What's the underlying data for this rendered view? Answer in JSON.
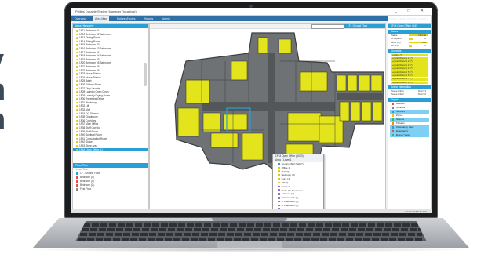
{
  "window": {
    "title": "Philips Durable System Manager (localhost)",
    "controls": "_ □ ✕"
  },
  "tabs": [
    "Overview",
    "Area Map",
    "Fixtures/Nodes",
    "Reports",
    "Admin"
  ],
  "active_tab": 1,
  "topbar_right": "admin  |  Signed in  |  Help  |  Logout",
  "left_panel": {
    "header": "Area Hierarchy",
    "areas": [
      "1F11 Bedroom 01",
      "1F12 Bedroom 02 Bathroom",
      "1F13 Dining Room",
      "1F14 Sitting Room",
      "1F15 Bedroom 03",
      "1F16 Bedroom 03 Bathroom",
      "1F17 Bedroom 04",
      "1F18 Bedroom 04 Bathroom",
      "1F19 Bedroom 05",
      "1F20 Bedroom 05 Bathroom",
      "1F21 Bedroom 06",
      "1F22 Bedroom 06",
      "1F23 Nurse Station",
      "1F24 Nurse Station",
      "1F25 Toilet",
      "1F26 Kitchen Room",
      "1F27 Dirty Laundry",
      "1F28 Laundry Open Clean",
      "1F29 Laundry Drying Room",
      "1F30 Receiving Office",
      "1F31 Workshop",
      "1F32 Lift",
      "1F33 Mail",
      "1F34 DQ Shower",
      "1F35 Cloakroom",
      "1F36 Corridors",
      "1F37 Main Office",
      "1F38 Staff Corridor",
      "1F39 Staff Room",
      "1F40 Spiritual Room",
      "1F41 Consultation Room",
      "1F42 Sluice",
      "1F43 Store Area",
      "1F44 Open Office (L)"
    ],
    "selected_index": 33,
    "legend_header": "Floor Plan",
    "legend_caption": "Level Tree",
    "legend": [
      {
        "label": "1F - Ground Floor",
        "color": "#2a9fd6"
      },
      {
        "label": "Bedroom (4)",
        "color": "#e05050"
      },
      {
        "label": "Bedroom (4)",
        "color": "#e05050"
      },
      {
        "label": "Bedroom (2)",
        "color": "#e05050"
      },
      {
        "label": "First Floor",
        "color": "#8a8a8a"
      }
    ]
  },
  "map_toolbar": {
    "search_placeholder": "",
    "button": "1F - Ground Floor"
  },
  "popup": {
    "title": "1F44 Open Office (N003)",
    "subtitle": "Area    1 Level 1",
    "groups": [
      {
        "label": "Groups: 8F2 Hall (7)",
        "color": "#2a9fd6"
      },
      {
        "label": "Office 1",
        "color": "#e6c21a"
      },
      {
        "label": "Hall (7)",
        "color": "#e6c21a"
      },
      {
        "label": "Bedroom (4)",
        "color": "#e6c21a"
      },
      {
        "label": "Core (4)",
        "color": "#e6c21a"
      },
      {
        "label": "Off (4)",
        "color": "#e6c21a"
      },
      {
        "label": "Controls",
        "color": "#9a6ac8"
      },
      {
        "label": "Node On   Set Scene",
        "color": "#9a6ac8"
      },
      {
        "label": "A   Scene (7)",
        "color": "#9a6ac8"
      },
      {
        "label": "B   Channel 1 (4)",
        "color": "#9a6ac8"
      },
      {
        "label": "C   Channel 2 (4)",
        "color": "#9a6ac8"
      },
      {
        "label": "D   Channel 3 (4)",
        "color": "#9a6ac8"
      },
      {
        "label": "E   Channel 4 (4)",
        "color": "#9a6ac8"
      }
    ]
  },
  "right_panel": {
    "area_button": "1F44 Open Office (N4)",
    "sections": {
      "status_header": "Status",
      "status": [
        {
          "label": "Status",
          "value": "Normal",
          "fill": 1.0
        },
        {
          "label": "Occupancy",
          "value": "0",
          "fill": 0.2
        },
        {
          "label": "Level (%)",
          "value": "100",
          "fill": 1.0
        },
        {
          "label": "Off (%)",
          "value": "0",
          "fill": 0.15
        }
      ],
      "channels_header": "Channels",
      "channels": [
        "Lighting (7)",
        "Logical Channel 1 (7)",
        "Logical Channel 2 (7)",
        "Logical Channel 3 (7)",
        "Logical Channel 4 (7)",
        "Logical Channel 5 (7)",
        "Logical Channel 6 (7)",
        "Logical Channel 7 (7)",
        "Logical Channel 8 (7)"
      ],
      "scene_header": "Scene Information",
      "scenes": [
        {
          "label": "Scene Info 1",
          "value": "DACT1"
        },
        {
          "label": "Scene Info 2",
          "value": "DACT2"
        }
      ],
      "layers_header": "Layers",
      "layers": [
        {
          "label": "Devices",
          "color": "#e05050",
          "on": false
        },
        {
          "label": "Controls",
          "color": "#9a6ac8",
          "on": false
        },
        {
          "label": "Sensors",
          "color": "#2a9fd6",
          "on": true
        },
        {
          "label": "Zones",
          "color": "#e6c21a",
          "on": false
        },
        {
          "label": "Scenes",
          "color": "#3cb371",
          "on": true
        },
        {
          "label": "Fixtures",
          "color": "#f08a24",
          "on": false
        },
        {
          "label": "Occupancy View",
          "color": "#2a9fd6",
          "on": true
        },
        {
          "label": "Emergency",
          "color": "#e05050",
          "on": true
        },
        {
          "label": "Energy View",
          "color": "#3cb371",
          "on": true
        }
      ]
    }
  },
  "statusbar": {
    "right": "Connected to Server"
  },
  "partial_heading": "y\nn\nn",
  "colors": {
    "accent": "#2a9fd6",
    "zone_yellow": "#e4e41c",
    "map_gray": "#6f7275"
  }
}
